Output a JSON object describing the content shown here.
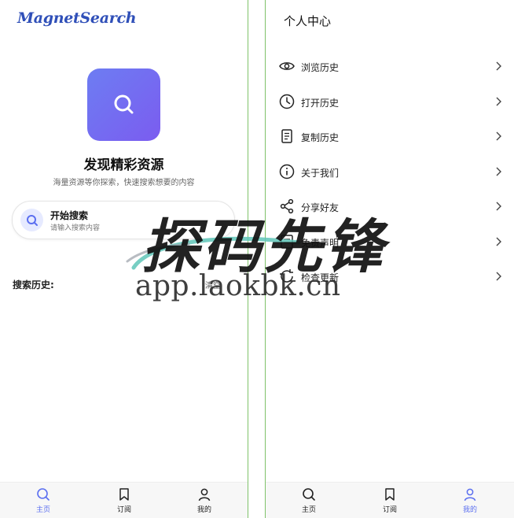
{
  "left": {
    "logo": "MagnetSearch",
    "hero_title": "发现精彩资源",
    "hero_subtitle": "海量资源等你探索，快速搜索想要的内容",
    "search_card": {
      "title": "开始搜索",
      "hint": "请输入搜索内容",
      "icon": "search-icon"
    },
    "history_label": "搜索历史:",
    "clear_label": "清空"
  },
  "right": {
    "title": "个人中心",
    "menu": [
      {
        "label": "浏览历史",
        "icon": "eye-icon"
      },
      {
        "label": "打开历史",
        "icon": "clock-icon"
      },
      {
        "label": "复制历史",
        "icon": "copy-icon"
      },
      {
        "label": "关于我们",
        "icon": "info-icon"
      },
      {
        "label": "分享好友",
        "icon": "share-icon"
      },
      {
        "label": "免责声明",
        "icon": "document-icon"
      },
      {
        "label": "检查更新",
        "icon": "refresh-icon"
      }
    ]
  },
  "nav_left": {
    "items": [
      {
        "label": "主页",
        "icon": "search-icon",
        "active": true
      },
      {
        "label": "订阅",
        "icon": "bookmark-icon",
        "active": false
      },
      {
        "label": "我的",
        "icon": "user-icon",
        "active": false
      }
    ]
  },
  "nav_right": {
    "items": [
      {
        "label": "主页",
        "icon": "search-icon",
        "active": false
      },
      {
        "label": "订阅",
        "icon": "bookmark-icon",
        "active": false
      },
      {
        "label": "我的",
        "icon": "user-icon",
        "active": true
      }
    ]
  },
  "watermark": {
    "text": "探码先锋",
    "url": "app.laokbk.cn"
  },
  "colors": {
    "accent": "#5b6ff0",
    "gradient_start": "#6d7df2",
    "gradient_end": "#7b5cf0",
    "divider": "#7fc26a"
  }
}
